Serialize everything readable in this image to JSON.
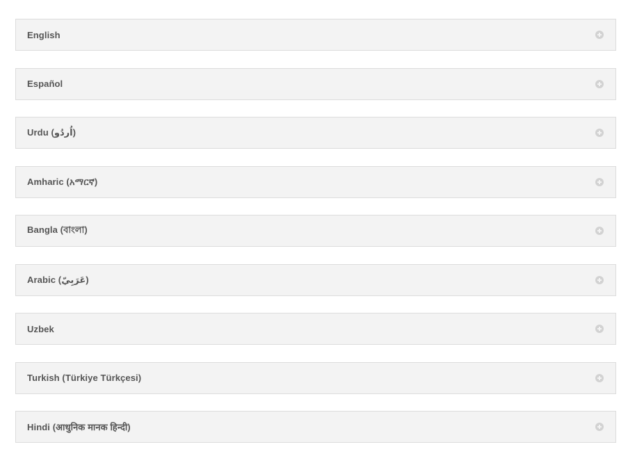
{
  "languages": {
    "items": [
      {
        "label": "English",
        "icon": "plus-circle-icon"
      },
      {
        "label": "Español",
        "icon": "plus-circle-icon"
      },
      {
        "label": "Urdu (اُردُو)",
        "icon": "plus-circle-icon"
      },
      {
        "label": "Amharic (አማርኛ)",
        "icon": "plus-circle-icon"
      },
      {
        "label": "Bangla (বাংলা)",
        "icon": "plus-circle-icon"
      },
      {
        "label": "Arabic (عَرَبِيّ)",
        "icon": "plus-circle-icon"
      },
      {
        "label": "Uzbek",
        "icon": "plus-circle-icon"
      },
      {
        "label": "Turkish (Türkiye Türkçesi)",
        "icon": "plus-circle-icon"
      },
      {
        "label": "Hindi (आधुनिक मानक हिन्दी)",
        "icon": "plus-circle-icon"
      }
    ]
  },
  "colors": {
    "panel_background": "#f3f3f3",
    "panel_border": "#dcdcdc",
    "label_text": "#555555",
    "icon": "#d2d2d2"
  }
}
